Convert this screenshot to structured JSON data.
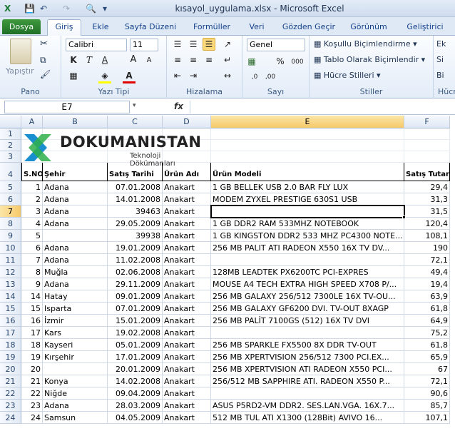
{
  "window": {
    "title": "kısayol_uygulama.xlsx  -  Microsoft Excel"
  },
  "ribbon_tabs": {
    "file": "Dosya",
    "items": [
      "Giriş",
      "Ekle",
      "Sayfa Düzeni",
      "Formüller",
      "Veri",
      "Gözden Geçir",
      "Görünüm",
      "Geliştirici"
    ],
    "active": "Giriş"
  },
  "ribbon": {
    "clipboard": {
      "label": "Pano",
      "paste": "Yapıştır"
    },
    "font": {
      "label": "Yazı Tipi",
      "name": "Calibri",
      "size": "11",
      "bold": "K",
      "italic": "T",
      "underline": "A",
      "grow": "A",
      "shrink": "A"
    },
    "alignment": {
      "label": "Hizalama"
    },
    "number": {
      "label": "Sayı",
      "format": "Genel",
      "percent": "%",
      "comma": "000"
    },
    "styles": {
      "label": "Stiller",
      "conditional": "Koşullu Biçimlendirme",
      "table": "Tablo Olarak Biçimlendir",
      "cell_styles": "Hücre Stilleri"
    },
    "cells": {
      "label": "Hücr",
      "e": "Ek",
      "s": "Si",
      "b": "Bi"
    }
  },
  "formula_bar": {
    "name_box": "E7",
    "fx": "fx",
    "value": ""
  },
  "logo": {
    "brand": "DOKUMANISTAN",
    "tagline": "Teknoloji Dökümanları",
    "accent": "#1a8fd0"
  },
  "columns": [
    "A",
    "B",
    "C",
    "D",
    "E",
    "F"
  ],
  "headers": {
    "sno": "S.NO",
    "city": "Şehir",
    "date": "Satış Tarihi",
    "product": "Ürün Adı",
    "model": "Ürün Modeli",
    "amount": "Satış Tutarı"
  },
  "rows": [
    {
      "r": "5",
      "a": "1",
      "b": "Adana",
      "c": "07.01.2008",
      "d": "Anakart",
      "e": "1 GB BELLEK USB 2.0 BAR FLY LUX",
      "f": "29,4"
    },
    {
      "r": "6",
      "a": "2",
      "b": "Adana",
      "c": "14.01.2008",
      "d": "Anakart",
      "e": "MODEM ZYXEL PRESTIGE 630S1 USB",
      "f": "31,3"
    },
    {
      "r": "7",
      "a": "3",
      "b": "Adana",
      "c": "39463",
      "d": "Anakart",
      "e": "",
      "f": "31,5"
    },
    {
      "r": "8",
      "a": "4",
      "b": "Adana",
      "c": "29.05.2009",
      "d": "Anakart",
      "e": "1 GB DDR2 RAM 533MHZ NOTEBOOK",
      "f": "120,4"
    },
    {
      "r": "9",
      "a": "5",
      "b": "",
      "c": "39938",
      "d": "Anakart",
      "e": "1 GB KINGSTON DDR2 533 MHZ PC4300 NOTE...",
      "f": "108,1"
    },
    {
      "r": "10",
      "a": "6",
      "b": "Adana",
      "c": "19.01.2009",
      "d": "Anakart",
      "e": "256 MB PALIT ATI RADEON X550 16X TV DV...",
      "f": "190"
    },
    {
      "r": "11",
      "a": "7",
      "b": "Adana",
      "c": "11.02.2008",
      "d": "Anakart",
      "e": "",
      "f": "72,1"
    },
    {
      "r": "12",
      "a": "8",
      "b": "Muğla",
      "c": "02.06.2008",
      "d": "Anakart",
      "e": "128MB LEADTEK PX6200TC PCI-EXPRES",
      "f": "49,4"
    },
    {
      "r": "13",
      "a": "9",
      "b": "Adana",
      "c": "29.11.2009",
      "d": "Anakart",
      "e": "MOUSE A4 TECH EXTRA HIGH SPEED X708 P/...",
      "f": "19,4"
    },
    {
      "r": "14",
      "a": "14",
      "b": "Hatay",
      "c": "09.01.2009",
      "d": "Anakart",
      "e": "256 MB GALAXY 256/512 7300LE 16X TV-OU...",
      "f": "63,9"
    },
    {
      "r": "15",
      "a": "15",
      "b": "Isparta",
      "c": "07.01.2009",
      "d": "Anakart",
      "e": "256 MB GALAXY GF6200 DVI. TV-OUT 8XAGP",
      "f": "61,8"
    },
    {
      "r": "16",
      "a": "16",
      "b": "İzmir",
      "c": "15.01.2009",
      "d": "Anakart",
      "e": "256 MB PALİT 7100GS (512) 16X TV DVI",
      "f": "64,9"
    },
    {
      "r": "17",
      "a": "17",
      "b": "Kars",
      "c": "19.02.2008",
      "d": "Anakart",
      "e": "",
      "f": "75,2"
    },
    {
      "r": "18",
      "a": "18",
      "b": "Kayseri",
      "c": "05.01.2009",
      "d": "Anakart",
      "e": "256 MB SPARKLE FX5500 8X DDR TV-OUT",
      "f": "61,8"
    },
    {
      "r": "19",
      "a": "19",
      "b": "Kırşehir",
      "c": "17.01.2009",
      "d": "Anakart",
      "e": "256 MB XPERTVISION 256/512 7300 PCI.EX...",
      "f": "65,9"
    },
    {
      "r": "20",
      "a": "20",
      "b": "",
      "c": "20.01.2009",
      "d": "Anakart",
      "e": "256 MB XPERTVISION ATI RADEON X550 PCI...",
      "f": "67"
    },
    {
      "r": "21",
      "a": "21",
      "b": "Konya",
      "c": "14.02.2008",
      "d": "Anakart",
      "e": "256/512 MB SAPPHIRE ATI. RADEON X550 P...",
      "f": "72,1"
    },
    {
      "r": "22",
      "a": "22",
      "b": "Niğde",
      "c": "09.04.2009",
      "d": "Anakart",
      "e": "",
      "f": "90,6"
    },
    {
      "r": "23",
      "a": "23",
      "b": "Adana",
      "c": "28.03.2009",
      "d": "Anakart",
      "e": "ASUS P5RD2-VM DDR2. SES.LAN.VGA. 16X.7...",
      "f": "85,7"
    },
    {
      "r": "24",
      "a": "24",
      "b": "Samsun",
      "c": "04.05.2009",
      "d": "Anakart",
      "e": "512 MB TUL ATI X1300 (128Bit) AVIVO 16...",
      "f": "107,1"
    }
  ]
}
